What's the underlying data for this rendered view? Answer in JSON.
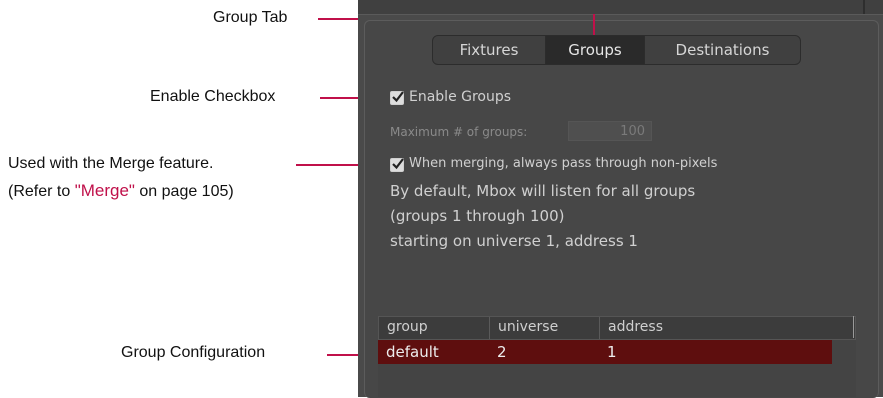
{
  "callouts": {
    "group_tab": "Group Tab",
    "enable_checkbox": "Enable Checkbox",
    "merge_line1": "Used with the Merge feature.",
    "merge_line2_prefix": "(Refer to ",
    "merge_link": "\"Merge\"",
    "merge_line2_suffix": " on page 105)",
    "group_configuration": "Group Configuration"
  },
  "tabs": [
    {
      "label": "Fixtures",
      "active": false
    },
    {
      "label": "Groups",
      "active": true
    },
    {
      "label": "Destinations",
      "active": false
    }
  ],
  "panel": {
    "enable_groups_label": "Enable Groups",
    "enable_groups_checked": true,
    "max_groups_label": "Maximum # of groups:",
    "max_groups_value": "100",
    "pass_through_label": "When merging, always pass through non-pixels",
    "pass_through_checked": true,
    "info_line1": "By default, Mbox will listen for all groups",
    "info_line2": "(groups 1 through 100)",
    "info_line3": "starting on universe 1, address 1"
  },
  "table": {
    "columns": [
      "group",
      "universe",
      "address"
    ],
    "rows": [
      {
        "group": "default",
        "universe": "2",
        "address": "1"
      }
    ]
  },
  "colors": {
    "callout_line": "#c0104a",
    "panel_bg": "#4a4a4a",
    "selected_row": "#5e0e0e"
  }
}
